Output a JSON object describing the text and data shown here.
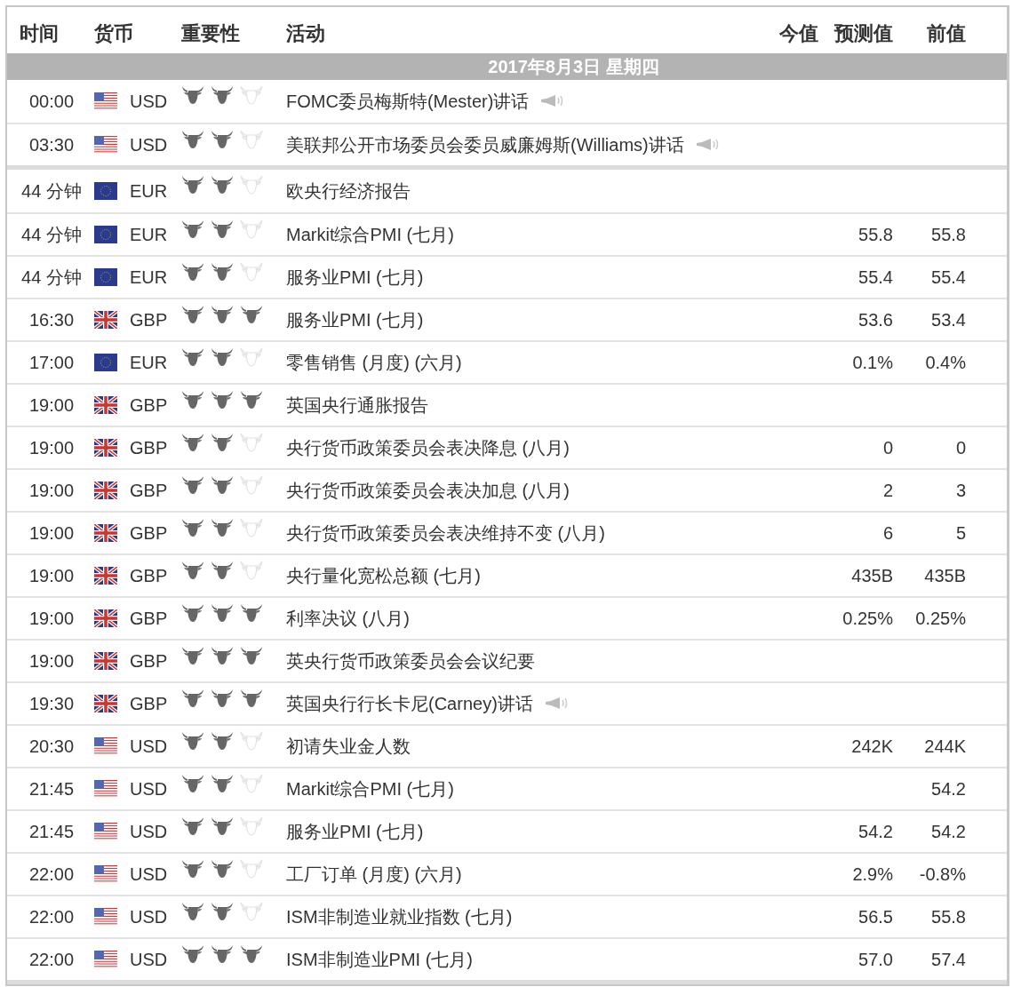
{
  "columns": [
    "时间",
    "货币",
    "重要性",
    "活动",
    "今值",
    "预测值",
    "前值"
  ],
  "date_bar": "2017年8月3日  星期四",
  "sections": [
    {
      "rows": [
        {
          "time": "00:00",
          "kind": "us",
          "currency": "USD",
          "stars": 2,
          "event": "FOMC委员梅斯特(Mester)讲话",
          "speech": true
        },
        {
          "time": "03:30",
          "kind": "us",
          "currency": "USD",
          "stars": 2,
          "event": "美联邦公开市场委员会委员威廉姆斯(Williams)讲话",
          "speech": true
        }
      ]
    },
    {
      "rows": [
        {
          "time": "44 分钟",
          "kind": "eu",
          "currency": "EUR",
          "stars": 2,
          "event": "欧央行经济报告",
          "speech": false
        },
        {
          "time": "44 分钟",
          "kind": "eu",
          "currency": "EUR",
          "stars": 2,
          "event": "Markit综合PMI (七月)",
          "speech": false,
          "forecast": "55.8",
          "previous": "55.8"
        },
        {
          "time": "44 分钟",
          "kind": "eu",
          "currency": "EUR",
          "stars": 2,
          "event": "服务业PMI (七月)",
          "speech": false,
          "forecast": "55.4",
          "previous": "55.4"
        },
        {
          "time": "16:30",
          "kind": "uk",
          "currency": "GBP",
          "stars": 3,
          "event": "服务业PMI (七月)",
          "speech": false,
          "forecast": "53.6",
          "previous": "53.4"
        },
        {
          "time": "17:00",
          "kind": "eu",
          "currency": "EUR",
          "stars": 2,
          "event": "零售销售 (月度) (六月)",
          "speech": false,
          "forecast": "0.1%",
          "previous": "0.4%"
        },
        {
          "time": "19:00",
          "kind": "uk",
          "currency": "GBP",
          "stars": 3,
          "event": "英国央行通胀报告",
          "speech": false
        },
        {
          "time": "19:00",
          "kind": "uk",
          "currency": "GBP",
          "stars": 2,
          "event": "央行货币政策委员会表决降息 (八月)",
          "speech": false,
          "forecast": "0",
          "previous": "0"
        },
        {
          "time": "19:00",
          "kind": "uk",
          "currency": "GBP",
          "stars": 2,
          "event": "央行货币政策委员会表决加息 (八月)",
          "speech": false,
          "forecast": "2",
          "previous": "3"
        },
        {
          "time": "19:00",
          "kind": "uk",
          "currency": "GBP",
          "stars": 2,
          "event": "央行货币政策委员会表决维持不变 (八月)",
          "speech": false,
          "forecast": "6",
          "previous": "5"
        },
        {
          "time": "19:00",
          "kind": "uk",
          "currency": "GBP",
          "stars": 2,
          "event": "央行量化宽松总额 (七月)",
          "speech": false,
          "forecast": "435B",
          "previous": "435B"
        },
        {
          "time": "19:00",
          "kind": "uk",
          "currency": "GBP",
          "stars": 3,
          "event": "利率决议 (八月)",
          "speech": false,
          "forecast": "0.25%",
          "previous": "0.25%"
        },
        {
          "time": "19:00",
          "kind": "uk",
          "currency": "GBP",
          "stars": 3,
          "event": "英央行货币政策委员会会议纪要",
          "speech": false
        },
        {
          "time": "19:30",
          "kind": "uk",
          "currency": "GBP",
          "stars": 3,
          "event": "英国央行行长卡尼(Carney)讲话",
          "speech": true
        },
        {
          "time": "20:30",
          "kind": "us",
          "currency": "USD",
          "stars": 2,
          "event": "初请失业金人数",
          "speech": false,
          "forecast": "242K",
          "previous": "244K"
        },
        {
          "time": "21:45",
          "kind": "us",
          "currency": "USD",
          "stars": 2,
          "event": "Markit综合PMI (七月)",
          "speech": false,
          "previous": "54.2"
        },
        {
          "time": "21:45",
          "kind": "us",
          "currency": "USD",
          "stars": 2,
          "event": "服务业PMI (七月)",
          "speech": false,
          "forecast": "54.2",
          "previous": "54.2"
        },
        {
          "time": "22:00",
          "kind": "us",
          "currency": "USD",
          "stars": 2,
          "event": "工厂订单 (月度) (六月)",
          "speech": false,
          "forecast": "2.9%",
          "previous": "-0.8%"
        },
        {
          "time": "22:00",
          "kind": "us",
          "currency": "USD",
          "stars": 2,
          "event": "ISM非制造业就业指数 (七月)",
          "speech": false,
          "forecast": "56.5",
          "previous": "55.8"
        },
        {
          "time": "22:00",
          "kind": "us",
          "currency": "USD",
          "stars": 3,
          "event": "ISM非制造业PMI (七月)",
          "speech": false,
          "forecast": "57.0",
          "previous": "57.4"
        }
      ]
    }
  ]
}
